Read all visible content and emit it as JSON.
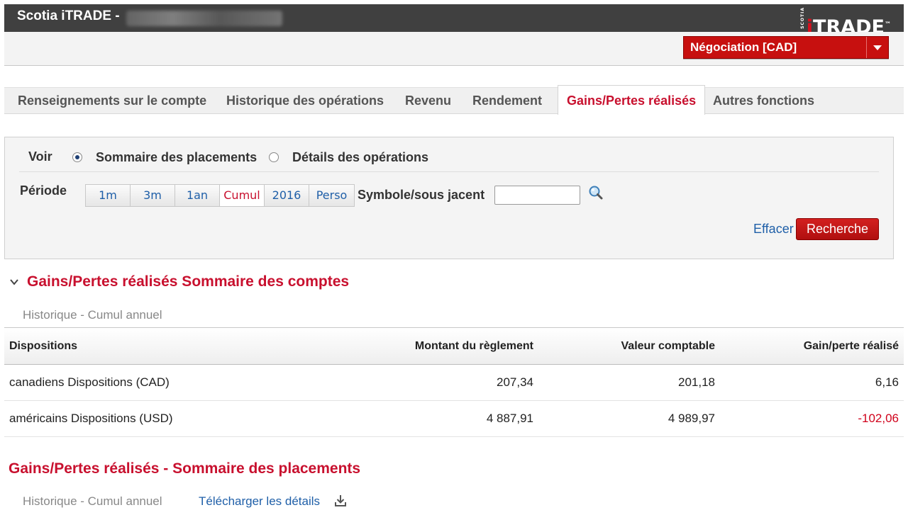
{
  "header": {
    "app_title": "Scotia iTRADE -",
    "logo_small": "SCOTIA",
    "logo_i": "i",
    "logo_rest": "TRADE",
    "logo_tm": "™",
    "account_selector": "Négociation [CAD]"
  },
  "tabs": [
    {
      "label": "Renseignements sur le compte"
    },
    {
      "label": "Historique des opérations"
    },
    {
      "label": "Revenu"
    },
    {
      "label": "Rendement"
    },
    {
      "label": "Gains/Pertes réalisés"
    },
    {
      "label": "Autres fonctions"
    }
  ],
  "filter": {
    "voir_label": "Voir",
    "options": [
      "Sommaire des placements",
      "Détails des opérations"
    ],
    "selected_option": "Sommaire des placements",
    "periode_label": "Période",
    "periods": [
      "1m",
      "3m",
      "1an",
      "Cumul",
      "2016",
      "Perso"
    ],
    "selected_period": "Cumul",
    "symbol_label": "Symbole/sous jacent",
    "symbol_value": "",
    "clear_label": "Effacer",
    "search_label": "Recherche"
  },
  "accounts_summary": {
    "title": "Gains/Pertes réalisés Sommaire des comptes",
    "subtitle": "Historique - Cumul annuel",
    "columns": [
      "Dispositions",
      "Montant du règlement",
      "Valeur comptable",
      "Gain/perte réalisé"
    ],
    "rows": [
      {
        "label": "canadiens Dispositions (CAD)",
        "montant": "207,34",
        "valeur": "201,18",
        "gain": "6,16"
      },
      {
        "label": "américains Dispositions (USD)",
        "montant": "4 887,91",
        "valeur": "4 989,97",
        "gain": "-102,06"
      }
    ]
  },
  "placements_summary": {
    "title": "Gains/Pertes réalisés - Sommaire des placements",
    "subtitle": "Historique - Cumul annuel",
    "download_label": "Télécharger les détails"
  },
  "colors": {
    "accent_red": "#c8102e",
    "link_blue": "#1f5fa8",
    "negative": "#d0021b",
    "topbar": "#404040"
  }
}
